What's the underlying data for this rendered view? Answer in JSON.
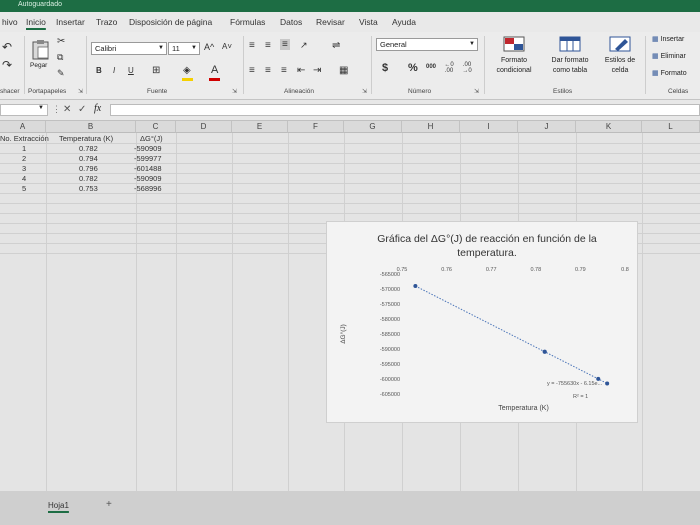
{
  "titlebar": {
    "autosave": "Autoguardado"
  },
  "menu": {
    "tabs": [
      "hivo",
      "Inicio",
      "Insertar",
      "Trazo",
      "Disposición de página",
      "Fórmulas",
      "Datos",
      "Revisar",
      "Vista",
      "Ayuda"
    ],
    "active": "Inicio"
  },
  "ribbon": {
    "paste_label": "Pegar",
    "font_name": "Calibri",
    "font_size": "11",
    "font_grow": "A^",
    "font_shrink": "A˅",
    "bold": "B",
    "italic": "I",
    "underline": "U",
    "number_format": "General",
    "currency": "$",
    "percent": "%",
    "thousands": "000",
    "decimals_increase": "←0 .00",
    "decimals_decrease": ".00 →0",
    "conditional_format": [
      "Formato",
      "condicional"
    ],
    "format_table": [
      "Dar formato",
      "como tabla"
    ],
    "cell_styles": [
      "Estilos de",
      "celda"
    ],
    "insert": "Insertar",
    "delete": "Eliminar",
    "format": "Formato",
    "groups": {
      "undo": "shacer",
      "clipboard": "Portapapeles",
      "font": "Fuente",
      "alignment": "Alineación",
      "number": "Número",
      "styles": "Estilos",
      "cells": "Celdas"
    },
    "accent": "#1d6d44"
  },
  "formula_bar": {
    "fx": "fx",
    "cancel": "✕",
    "confirm": "✓",
    "value": ""
  },
  "columns": [
    "A",
    "B",
    "C",
    "D",
    "E",
    "F",
    "G",
    "H",
    "I",
    "J",
    "K",
    "L"
  ],
  "table": {
    "headers": [
      "No. Extracción",
      "Temperatura (K)",
      "ΔG°(J)"
    ],
    "rows": [
      [
        "1",
        "0.782",
        "-590909"
      ],
      [
        "2",
        "0.794",
        "-599977"
      ],
      [
        "3",
        "0.796",
        "-601488"
      ],
      [
        "4",
        "0.782",
        "-590909"
      ],
      [
        "5",
        "0.753",
        "-568996"
      ]
    ]
  },
  "chart_data": {
    "type": "scatter",
    "title": "Gráfica del ΔG°(J) de reacción en función de la temperatura.",
    "xlabel": "Temperatura (K)",
    "ylabel": "ΔG°(J)",
    "xlim": [
      0.75,
      0.8
    ],
    "ylim": [
      -605000,
      -565000
    ],
    "x_ticks": [
      "0.75",
      "0.76",
      "0.77",
      "0.78",
      "0.79",
      "0.8"
    ],
    "y_ticks": [
      "-565000",
      "-570000",
      "-575000",
      "-580000",
      "-585000",
      "-590000",
      "-595000",
      "-600000",
      "-605000"
    ],
    "series": [
      {
        "x": [
          0.782,
          0.794,
          0.796,
          0.782,
          0.753
        ],
        "y": [
          -590909,
          -599977,
          -601488,
          -590909,
          -568996
        ]
      }
    ],
    "trendline": {
      "x": [
        0.753,
        0.796
      ],
      "y": [
        -568996,
        -601488
      ],
      "style": "dotted"
    },
    "equation": "y = -755630x - 6.15e...",
    "r2": "R² = 1",
    "marker_color": "#2f5597"
  },
  "sheet": {
    "tab": "Hoja1",
    "add": "+"
  }
}
